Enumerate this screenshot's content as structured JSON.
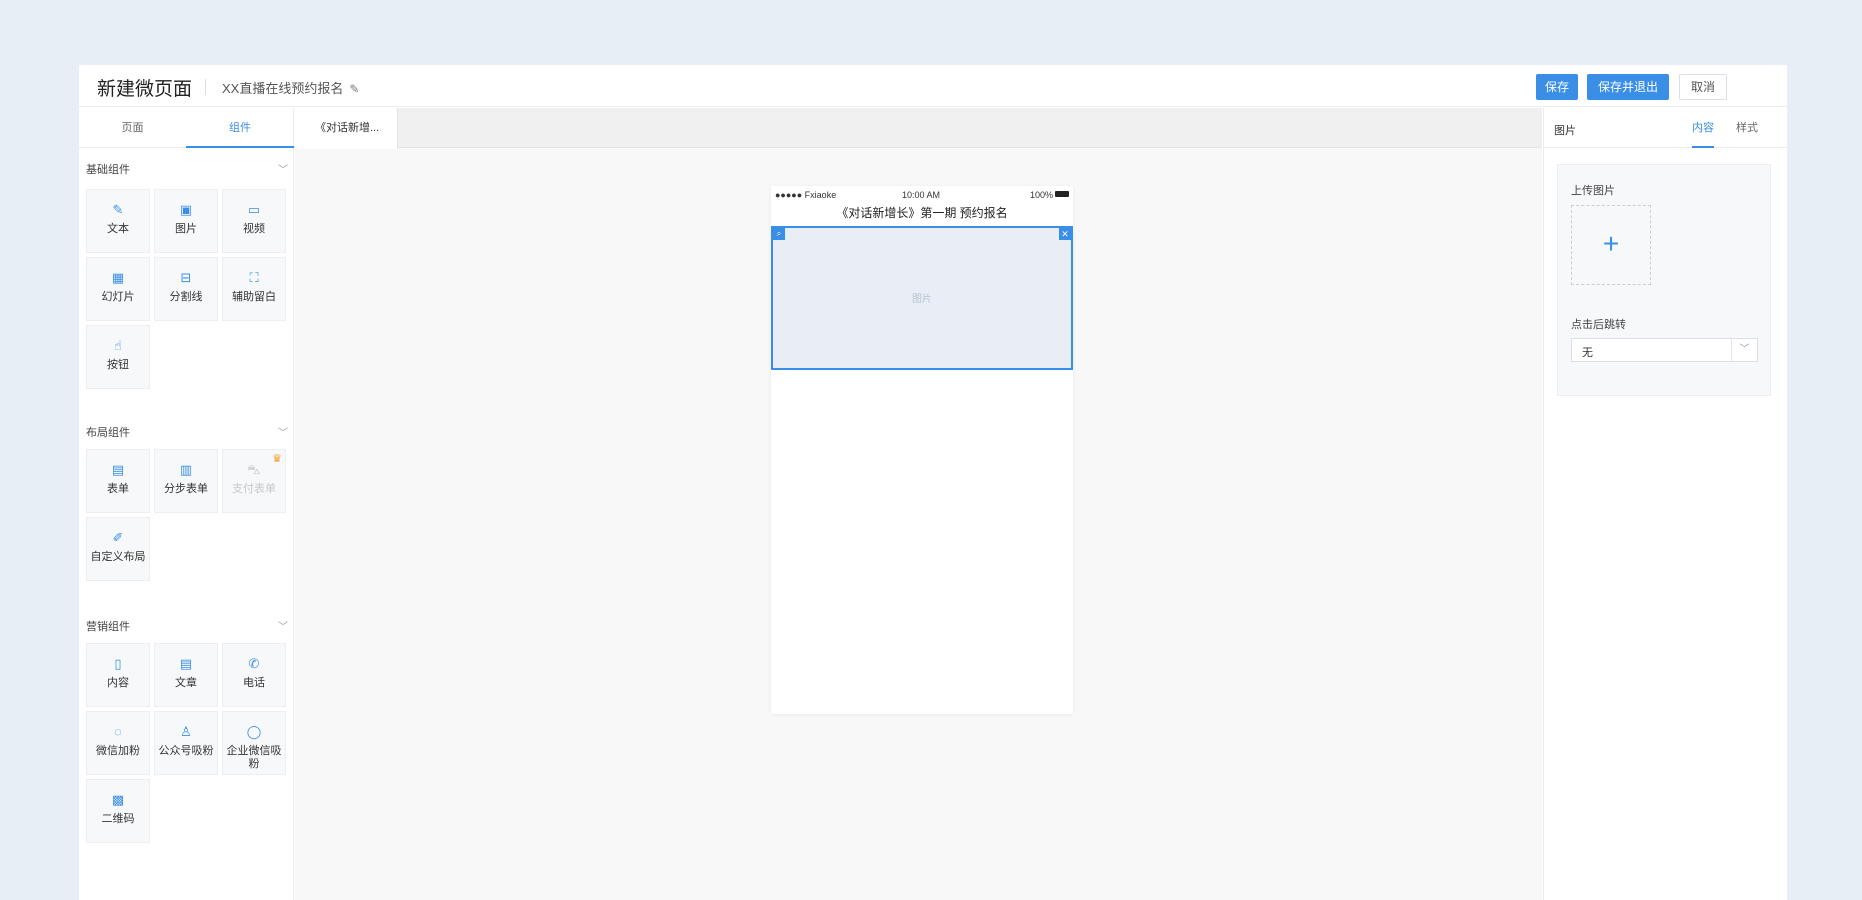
{
  "header": {
    "title": "新建微页面",
    "subtitle": "XX直播在线预约报名",
    "edit_icon": "pencil-icon",
    "save_label": "保存",
    "save_exit_label": "保存并退出",
    "cancel_label": "取消"
  },
  "left_panel": {
    "tabs": [
      "页面",
      "组件"
    ],
    "active_tab": "组件",
    "groups": [
      {
        "title": "基础组件",
        "items": [
          {
            "label": "文本",
            "icon": "edit-icon"
          },
          {
            "label": "图片",
            "icon": "image-icon"
          },
          {
            "label": "视频",
            "icon": "video-icon"
          },
          {
            "label": "幻灯片",
            "icon": "slideshow-icon"
          },
          {
            "label": "分割线",
            "icon": "divider-icon"
          },
          {
            "label": "辅助留白",
            "icon": "whitespace-icon"
          },
          {
            "label": "按钮",
            "icon": "pointer-icon"
          }
        ]
      },
      {
        "title": "布局组件",
        "items": [
          {
            "label": "表单",
            "icon": "form-icon"
          },
          {
            "label": "分步表单",
            "icon": "step-form-icon"
          },
          {
            "label": "支付表单",
            "icon": "cart-icon",
            "disabled": true,
            "badge": "crown-icon"
          },
          {
            "label": "自定义布局",
            "icon": "pen-icon"
          }
        ]
      },
      {
        "title": "营销组件",
        "items": [
          {
            "label": "内容",
            "icon": "book-icon"
          },
          {
            "label": "文章",
            "icon": "document-icon"
          },
          {
            "label": "电话",
            "icon": "phone-icon"
          },
          {
            "label": "微信加粉",
            "icon": "chat-icon"
          },
          {
            "label": "公众号吸粉",
            "icon": "user-icon"
          },
          {
            "label": "企业微信吸粉",
            "icon": "chat-bubble-icon"
          },
          {
            "label": "二维码",
            "icon": "qrcode-icon"
          }
        ]
      }
    ]
  },
  "canvas": {
    "page_tab": "《对话新增...",
    "phone": {
      "carrier": "●●●●● Fxiaoke",
      "time": "10:00 AM",
      "battery": "100%",
      "page_title": "《对话新增长》第一期 预约报名",
      "image_placeholder": "图片"
    }
  },
  "right_panel": {
    "title": "图片",
    "tabs": [
      "内容",
      "样式"
    ],
    "active_tab": "内容",
    "upload_label": "上传图片",
    "upload_icon": "plus-icon",
    "jump_label": "点击后跳转",
    "jump_value": "无"
  },
  "colors": {
    "primary": "#3a8ee6",
    "background": "#e8eef6",
    "crown": "#f39a2b"
  }
}
